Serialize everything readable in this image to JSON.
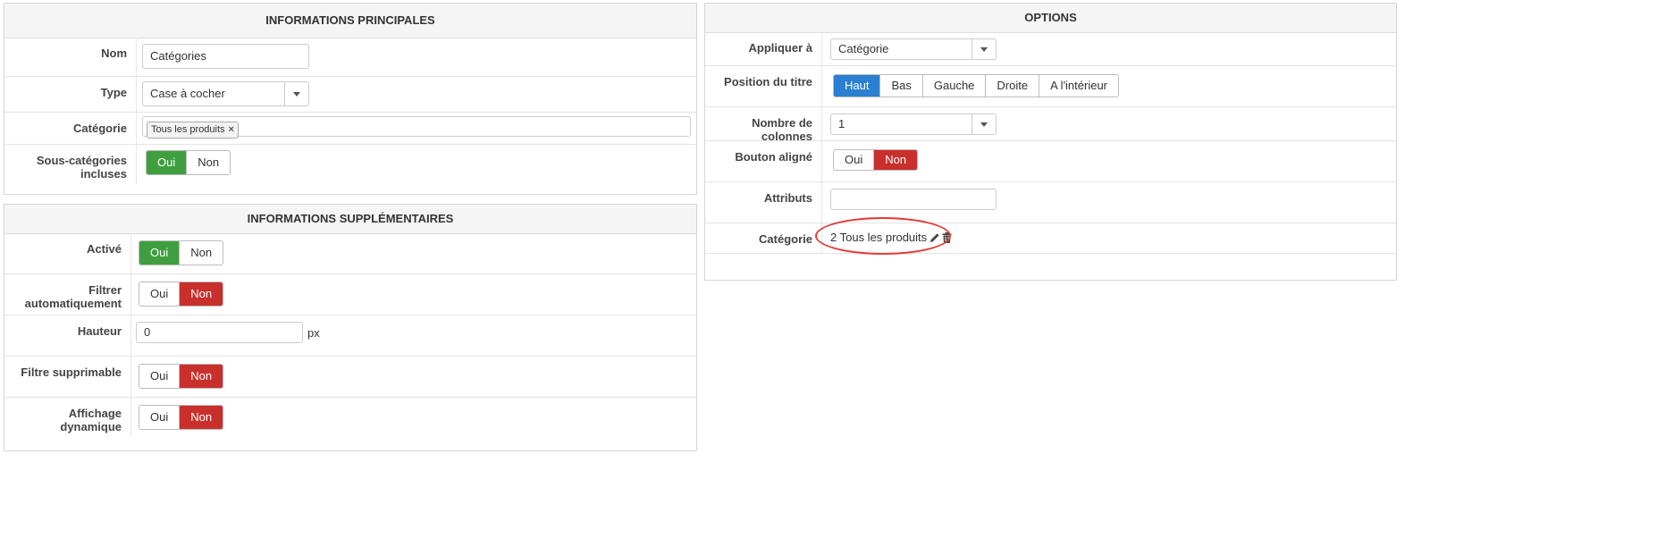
{
  "left_main": {
    "title": "INFORMATIONS PRINCIPALES",
    "nom": {
      "label": "Nom",
      "value": "Catégories"
    },
    "type": {
      "label": "Type",
      "value": "Case à cocher"
    },
    "categorie": {
      "label": "Catégorie",
      "tag": "Tous les produits",
      "tag_remove": "×"
    },
    "sous_categories": {
      "label": "Sous-catégories incluses",
      "yes": "Oui",
      "no": "Non",
      "selected": "Oui"
    }
  },
  "left_extra": {
    "title": "INFORMATIONS SUPPLÉMENTAIRES",
    "active": {
      "label": "Activé",
      "yes": "Oui",
      "no": "Non",
      "selected": "Oui"
    },
    "filtrer": {
      "label": "Filtrer automatiquement",
      "yes": "Oui",
      "no": "Non",
      "selected": "Non"
    },
    "hauteur": {
      "label": "Hauteur",
      "value": "0",
      "unit": "px"
    },
    "filtre_supprimable": {
      "label": "Filtre supprimable",
      "yes": "Oui",
      "no": "Non",
      "selected": "Non"
    },
    "affichage": {
      "label": "Affichage dynamique",
      "yes": "Oui",
      "no": "Non",
      "selected": "Non"
    }
  },
  "options": {
    "title": "OPTIONS",
    "appliquer": {
      "label": "Appliquer à",
      "value": "Catégorie"
    },
    "position": {
      "label": "Position du titre",
      "choices": [
        "Haut",
        "Bas",
        "Gauche",
        "Droite",
        "A l'intérieur"
      ],
      "selected": "Haut"
    },
    "colonnes": {
      "label": "Nombre de colonnes",
      "value": "1"
    },
    "bouton": {
      "label": "Bouton aligné",
      "yes": "Oui",
      "no": "Non",
      "selected": "Non"
    },
    "attributs": {
      "label": "Attributs",
      "value": ""
    },
    "categorie": {
      "label": "Catégorie",
      "value": "2 Tous les produits",
      "icons": [
        "pencil-icon",
        "trash-icon"
      ]
    }
  },
  "colors": {
    "green": "#3f9f3f",
    "red": "#c9302c",
    "blue": "#2a7fd0",
    "highlight": "#e53935"
  }
}
